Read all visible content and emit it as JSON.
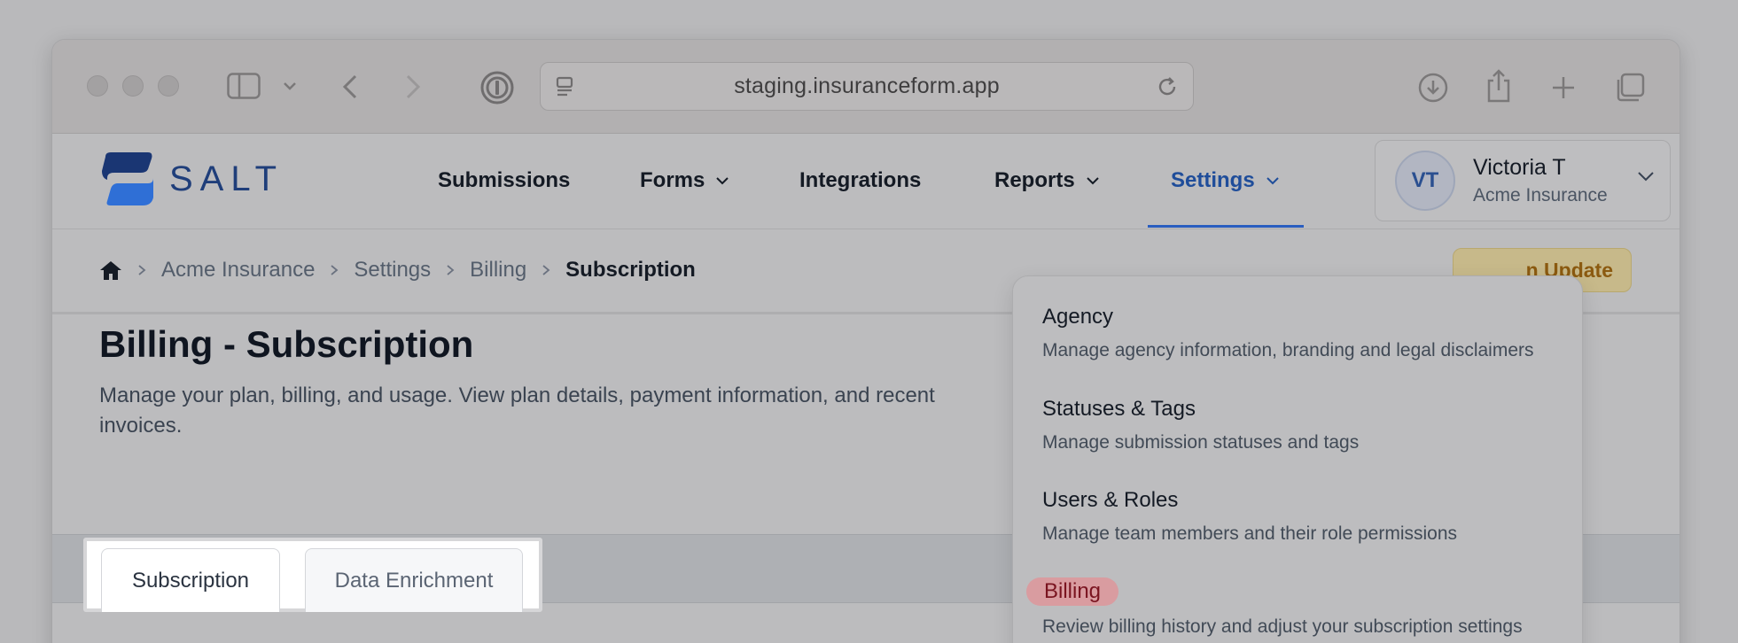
{
  "browser": {
    "url": "staging.insuranceform.app"
  },
  "header": {
    "logo_text": "SALT",
    "nav": [
      {
        "label": "Submissions"
      },
      {
        "label": "Forms"
      },
      {
        "label": "Integrations"
      },
      {
        "label": "Reports"
      },
      {
        "label": "Settings"
      }
    ],
    "user": {
      "initials": "VT",
      "name": "Victoria T",
      "org": "Acme Insurance"
    }
  },
  "breadcrumb": {
    "items": [
      "Acme Insurance",
      "Settings",
      "Billing",
      "Subscription"
    ]
  },
  "update_button": "n Update",
  "main": {
    "title": "Billing - Subscription",
    "description": "Manage your plan, billing, and usage. View plan details, payment information, and recent invoices."
  },
  "tabs": [
    "Subscription",
    "Data Enrichment"
  ],
  "settings_menu": [
    {
      "title": "Agency",
      "desc": "Manage agency information, branding and legal disclaimers"
    },
    {
      "title": "Statuses & Tags",
      "desc": "Manage submission statuses and tags"
    },
    {
      "title": "Users & Roles",
      "desc": "Manage team members and their role permissions"
    },
    {
      "title": "Billing",
      "desc": "Review billing history and adjust your subscription settings"
    }
  ],
  "colors": {
    "accent": "#2a5ec0",
    "highlight": "#d99ca0",
    "update_badge": "#c7b98a"
  }
}
